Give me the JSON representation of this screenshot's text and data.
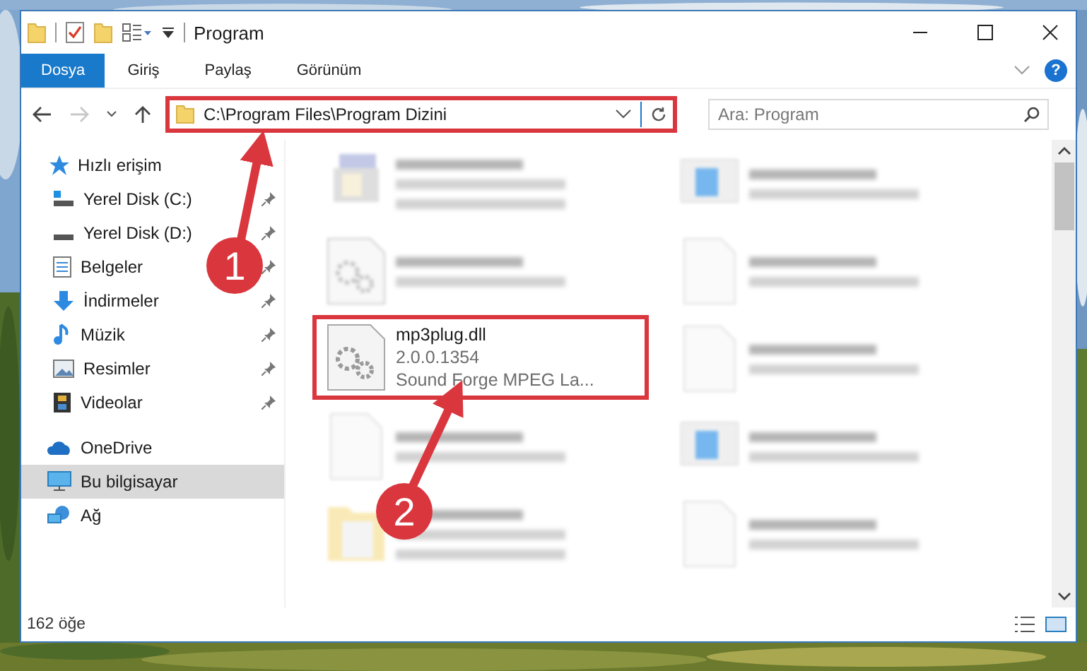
{
  "window": {
    "title": "Program"
  },
  "ribbon": {
    "tabs": [
      {
        "label": "Dosya",
        "selected": true
      },
      {
        "label": "Giriş",
        "selected": false
      },
      {
        "label": "Paylaş",
        "selected": false
      },
      {
        "label": "Görünüm",
        "selected": false
      }
    ],
    "help": "?"
  },
  "address": {
    "path": "C:\\Program Files\\Program Dizini",
    "highlighted": true,
    "forward_disabled": true
  },
  "search": {
    "placeholder": "Ara: Program"
  },
  "sidebar": {
    "items": [
      {
        "label": "Hızlı erişim",
        "selected": false,
        "children": [
          {
            "label": "Yerel Disk (C:)",
            "pinned": true
          },
          {
            "label": "Yerel Disk (D:)",
            "pinned": true
          },
          {
            "label": "Belgeler",
            "pinned": true
          },
          {
            "label": "İndirmeler",
            "pinned": true
          },
          {
            "label": "Müzik",
            "pinned": true
          },
          {
            "label": "Resimler",
            "pinned": true
          },
          {
            "label": "Videolar",
            "pinned": true
          }
        ]
      },
      {
        "label": "OneDrive",
        "selected": false
      },
      {
        "label": "Bu bilgisayar",
        "selected": true
      },
      {
        "label": "Ağ",
        "selected": false
      }
    ]
  },
  "files": [
    {
      "kind": "blurred"
    },
    {
      "kind": "blurred"
    },
    {
      "kind": "blurred"
    },
    {
      "kind": "blurred"
    },
    {
      "kind": "file",
      "name": "mp3plug.dll",
      "version": "2.0.0.1354",
      "description": "Sound Forge MPEG La...",
      "highlighted": true
    },
    {
      "kind": "blurred"
    },
    {
      "kind": "blurred"
    },
    {
      "kind": "blurred"
    },
    {
      "kind": "blurred"
    },
    {
      "kind": "blurred"
    }
  ],
  "status_bar": {
    "count": "162 öğe"
  },
  "annotations": [
    {
      "number": "1"
    },
    {
      "number": "2"
    }
  ]
}
